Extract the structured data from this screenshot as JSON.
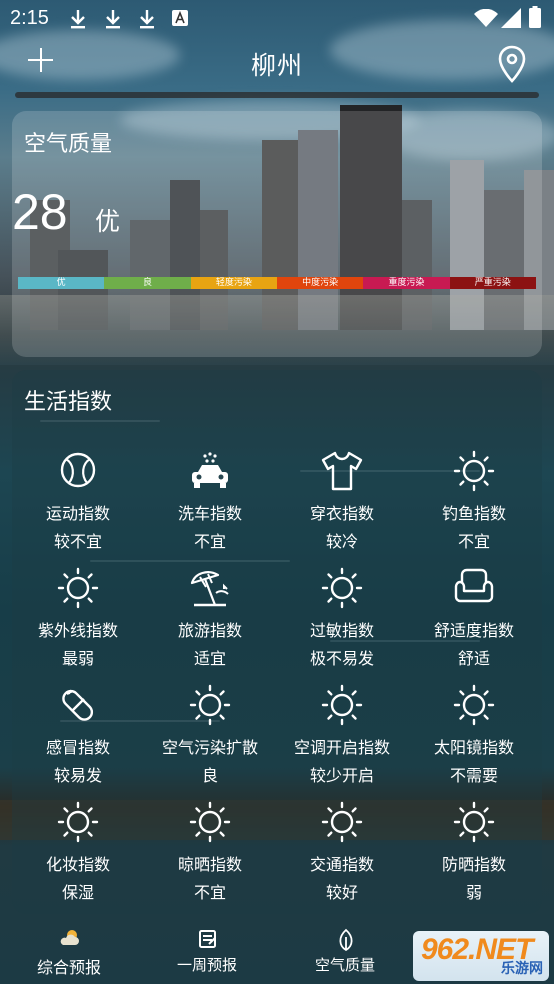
{
  "status_bar": {
    "time": "2:15"
  },
  "header": {
    "city": "柳州"
  },
  "air_quality": {
    "title": "空气质量",
    "aqi": "28",
    "level": "优",
    "scale": [
      {
        "label": "优",
        "color": "#5ab7c6"
      },
      {
        "label": "良",
        "color": "#6fae4a"
      },
      {
        "label": "轻度污染",
        "color": "#e8a412"
      },
      {
        "label": "中度污染",
        "color": "#e0450d"
      },
      {
        "label": "重度污染",
        "color": "#c81a52"
      },
      {
        "label": "严重污染",
        "color": "#8c1212"
      }
    ]
  },
  "life_index": {
    "title": "生活指数",
    "items": [
      {
        "icon": "tennis-ball-icon",
        "name": "运动指数",
        "value": "较不宜"
      },
      {
        "icon": "car-wash-icon",
        "name": "洗车指数",
        "value": "不宜"
      },
      {
        "icon": "tshirt-icon",
        "name": "穿衣指数",
        "value": "较冷"
      },
      {
        "icon": "sun-icon",
        "name": "钓鱼指数",
        "value": "不宜"
      },
      {
        "icon": "sun-icon",
        "name": "紫外线指数",
        "value": "最弱"
      },
      {
        "icon": "beach-umbrella-icon",
        "name": "旅游指数",
        "value": "适宜"
      },
      {
        "icon": "sun-icon",
        "name": "过敏指数",
        "value": "极不易发"
      },
      {
        "icon": "armchair-icon",
        "name": "舒适度指数",
        "value": "舒适"
      },
      {
        "icon": "pill-icon",
        "name": "感冒指数",
        "value": "较易发"
      },
      {
        "icon": "sun-icon",
        "name": "空气污染扩散",
        "value": "良"
      },
      {
        "icon": "sun-icon",
        "name": "空调开启指数",
        "value": "较少开启"
      },
      {
        "icon": "sun-icon",
        "name": "太阳镜指数",
        "value": "不需要"
      },
      {
        "icon": "sun-icon",
        "name": "化妆指数",
        "value": "保湿"
      },
      {
        "icon": "sun-icon",
        "name": "晾晒指数",
        "value": "不宜"
      },
      {
        "icon": "sun-icon",
        "name": "交通指数",
        "value": "较好"
      },
      {
        "icon": "sun-icon",
        "name": "防晒指数",
        "value": "弱"
      }
    ]
  },
  "bottom_nav": {
    "items": [
      {
        "label": "综合预报",
        "icon": "partly-cloudy-icon"
      },
      {
        "label": "一周预报",
        "icon": "calendar-icon"
      },
      {
        "label": "空气质量",
        "icon": "leaf-icon"
      }
    ]
  },
  "watermark": {
    "brand": "962.NET",
    "sub": "乐游网"
  }
}
